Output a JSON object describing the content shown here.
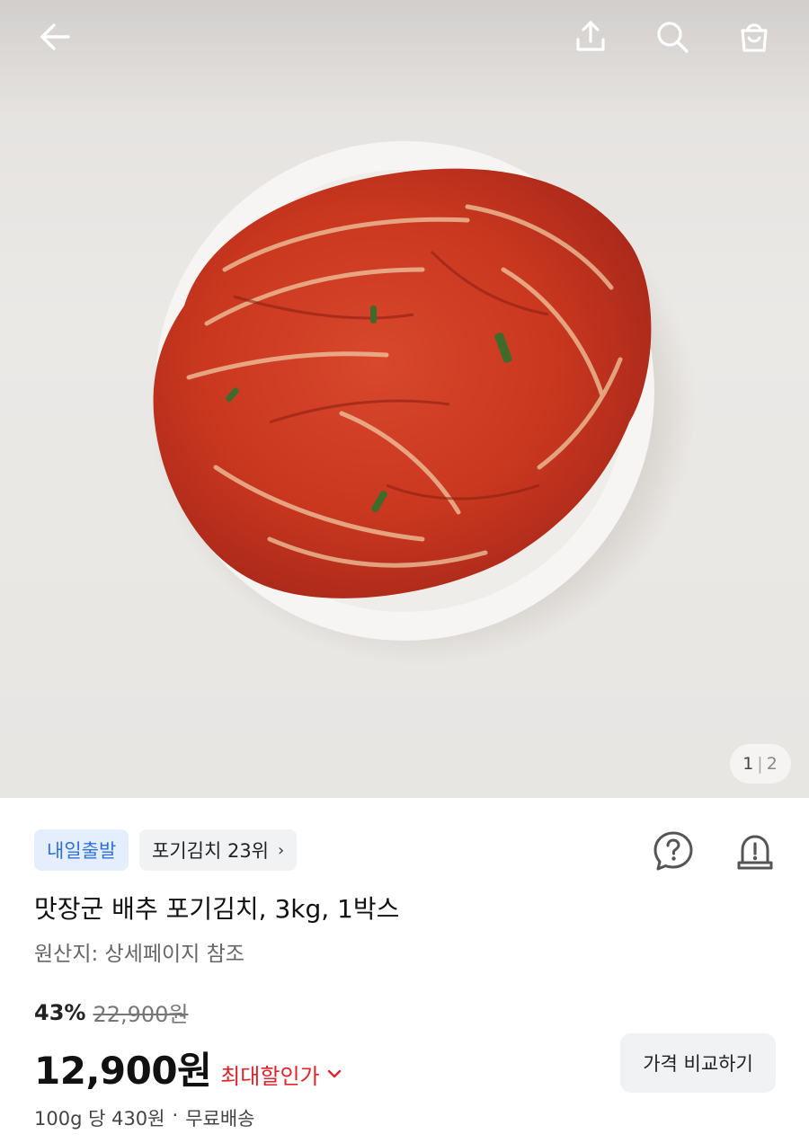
{
  "topbar": {
    "icons": [
      "back-arrow-icon",
      "share-icon",
      "search-icon",
      "cart-icon"
    ]
  },
  "gallery": {
    "current": "1",
    "separator": "|",
    "total": "2"
  },
  "badges": {
    "delivery": "내일출발",
    "rank": "포기김치 23위",
    "rank_chevron": "›"
  },
  "actions": {
    "icons": [
      "question-icon",
      "alert-icon"
    ]
  },
  "product": {
    "title": "맛장군 배추 포기김치, 3kg, 1박스",
    "origin": "원산지: 상세페이지 참조"
  },
  "pricing": {
    "discount": "43%",
    "original_price": "22,900원",
    "price": "12,900원",
    "max_discount_label": "최대할인가",
    "max_discount_chevron": "⌄",
    "compare_button": "가격 비교하기",
    "unit_price": "100g 당 430원",
    "dot": "·",
    "shipping": "무료배송",
    "accent_color": "#e0242c"
  },
  "colors": {
    "badge_blue_text": "#2f6fe0",
    "badge_blue_bg": "#e5eefc"
  }
}
